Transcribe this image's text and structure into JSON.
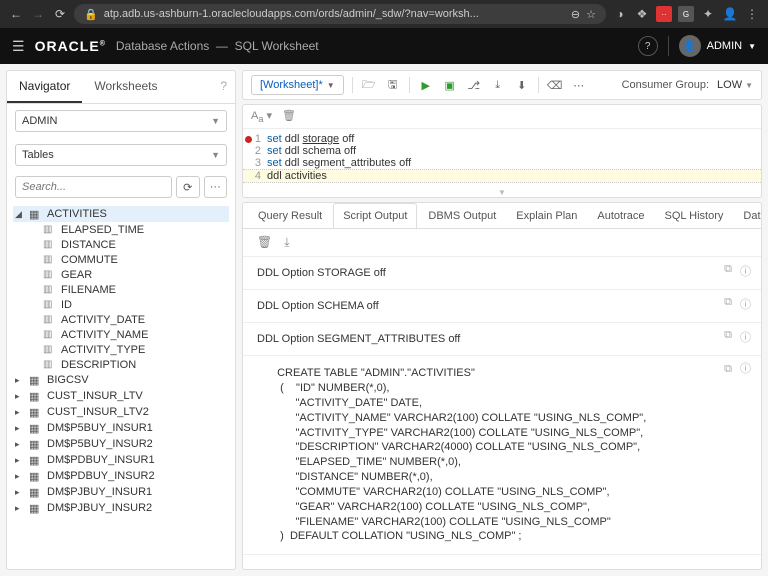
{
  "browser": {
    "url": "atp.adb.us-ashburn-1.oraclecloudapps.com/ords/admin/_sdw/?nav=worksh..."
  },
  "header": {
    "logo": "ORACLE",
    "product": "Database Actions",
    "section": "SQL Worksheet",
    "user": "ADMIN"
  },
  "sidebar": {
    "tabs": [
      "Navigator",
      "Worksheets"
    ],
    "active_tab": "Navigator",
    "schema_select": "ADMIN",
    "object_type_select": "Tables",
    "search_placeholder": "Search...",
    "expanded_table": "ACTIVITIES",
    "columns": [
      "ELAPSED_TIME",
      "DISTANCE",
      "COMMUTE",
      "GEAR",
      "FILENAME",
      "ID",
      "ACTIVITY_DATE",
      "ACTIVITY_NAME",
      "ACTIVITY_TYPE",
      "DESCRIPTION"
    ],
    "other_tables": [
      "BIGCSV",
      "CUST_INSUR_LTV",
      "CUST_INSUR_LTV2",
      "DM$P5BUY_INSUR1",
      "DM$P5BUY_INSUR2",
      "DM$PDBUY_INSUR1",
      "DM$PDBUY_INSUR2",
      "DM$PJBUY_INSUR1",
      "DM$PJBUY_INSUR2"
    ]
  },
  "toolbar": {
    "worksheet_label": "[Worksheet]*",
    "consumer_group_label": "Consumer Group:",
    "consumer_group_value": "LOW"
  },
  "editor": {
    "lines": [
      {
        "n": 1,
        "bp": true,
        "tokens": [
          {
            "t": "set",
            "k": true
          },
          {
            "t": " ddl "
          },
          {
            "t": "storage",
            "u": true
          },
          {
            "t": " off"
          }
        ]
      },
      {
        "n": 2,
        "tokens": [
          {
            "t": "set",
            "k": true
          },
          {
            "t": " ddl schema off"
          }
        ]
      },
      {
        "n": 3,
        "tokens": [
          {
            "t": "set",
            "k": true
          },
          {
            "t": " ddl segment_attributes off"
          }
        ]
      },
      {
        "n": 4,
        "current": true,
        "tokens": [
          {
            "t": "ddl activities"
          }
        ]
      }
    ]
  },
  "results": {
    "tabs": [
      "Query Result",
      "Script Output",
      "DBMS Output",
      "Explain Plan",
      "Autotrace",
      "SQL History",
      "Data Loading"
    ],
    "active_tab": "Script Output",
    "blocks": [
      {
        "text": "DDL Option STORAGE off"
      },
      {
        "text": "DDL Option SCHEMA off"
      },
      {
        "text": "DDL Option SEGMENT_ATTRIBUTES off"
      },
      {
        "code": true,
        "text": "  CREATE TABLE \"ADMIN\".\"ACTIVITIES\"\n   (    \"ID\" NUMBER(*,0),\n        \"ACTIVITY_DATE\" DATE,\n        \"ACTIVITY_NAME\" VARCHAR2(100) COLLATE \"USING_NLS_COMP\",\n        \"ACTIVITY_TYPE\" VARCHAR2(100) COLLATE \"USING_NLS_COMP\",\n        \"DESCRIPTION\" VARCHAR2(4000) COLLATE \"USING_NLS_COMP\",\n        \"ELAPSED_TIME\" NUMBER(*,0),\n        \"DISTANCE\" NUMBER(*,0),\n        \"COMMUTE\" VARCHAR2(10) COLLATE \"USING_NLS_COMP\",\n        \"GEAR\" VARCHAR2(100) COLLATE \"USING_NLS_COMP\",\n        \"FILENAME\" VARCHAR2(100) COLLATE \"USING_NLS_COMP\"\n   )  DEFAULT COLLATION \"USING_NLS_COMP\" ;"
      }
    ]
  }
}
